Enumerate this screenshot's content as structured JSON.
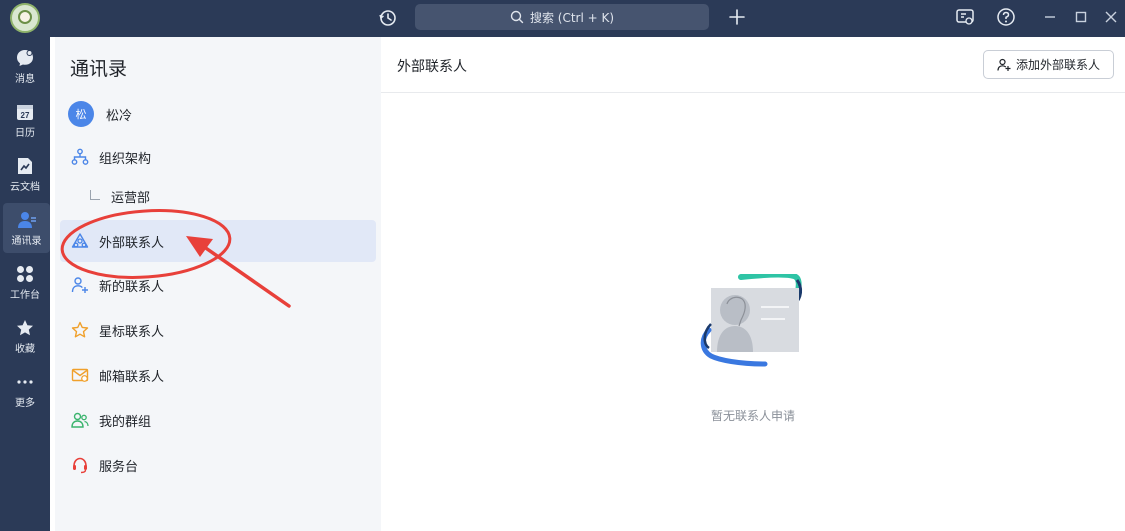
{
  "topbar": {
    "search_placeholder": "搜索 (Ctrl + K)"
  },
  "rail": {
    "items": [
      {
        "label": "消息",
        "icon": "message-icon"
      },
      {
        "label": "日历",
        "icon": "calendar-icon",
        "badge": "27"
      },
      {
        "label": "云文档",
        "icon": "cloud-doc-icon"
      },
      {
        "label": "通讯录",
        "icon": "contacts-icon"
      },
      {
        "label": "工作台",
        "icon": "workbench-icon"
      },
      {
        "label": "收藏",
        "icon": "star-icon"
      },
      {
        "label": "更多",
        "icon": "more-icon"
      }
    ]
  },
  "panel": {
    "title": "通讯录",
    "user": {
      "initial": "松",
      "name": "松冷"
    },
    "items": [
      {
        "label": "组织架构"
      },
      {
        "label": "运营部"
      },
      {
        "label": "外部联系人"
      },
      {
        "label": "新的联系人"
      },
      {
        "label": "星标联系人"
      },
      {
        "label": "邮箱联系人"
      },
      {
        "label": "我的群组"
      },
      {
        "label": "服务台"
      }
    ]
  },
  "main": {
    "title": "外部联系人",
    "add_button": "添加外部联系人",
    "empty_text": "暂无联系人申请"
  },
  "colors": {
    "accent": "#4b86e8",
    "annotation": "#e8403a",
    "sidebar_bg": "#2b3a57"
  }
}
